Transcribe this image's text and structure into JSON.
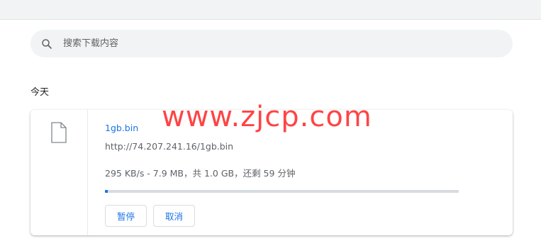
{
  "search": {
    "placeholder": "搜索下载内容",
    "icon": "search-icon"
  },
  "section": {
    "title": "今天"
  },
  "download": {
    "file_name": "1gb.bin",
    "url": "http://74.207.241.16/1gb.bin",
    "status": "295 KB/s - 7.9 MB，共 1.0 GB，还剩 59 分钟",
    "progress": 0.0077,
    "icon": "file-icon",
    "pause_label": "暂停",
    "cancel_label": "取消"
  },
  "watermark": {
    "text": "www.zjcp.com"
  },
  "colors": {
    "accent": "#1a73e8",
    "watermark": "#ff3b3b",
    "track": "#d7dbdf"
  }
}
